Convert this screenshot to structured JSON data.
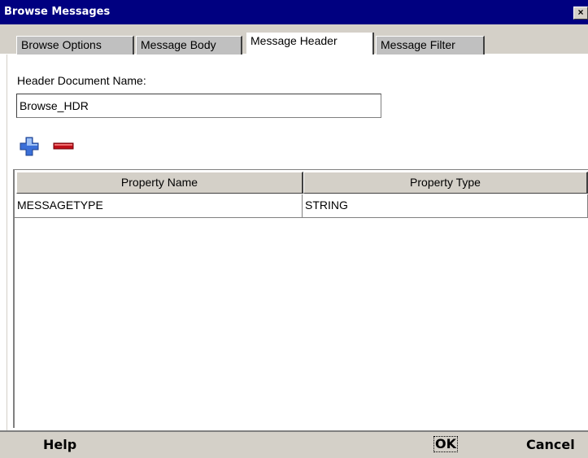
{
  "window": {
    "title": "Browse Messages",
    "close_symbol": "×"
  },
  "tabs": [
    {
      "label": "Browse Options",
      "active": false
    },
    {
      "label": "Message Body",
      "active": false
    },
    {
      "label": "Message Header",
      "active": true
    },
    {
      "label": "Message Filter",
      "active": false
    }
  ],
  "form": {
    "header_document_label": "Header Document Name:",
    "header_document_value": "Browse_HDR"
  },
  "toolbar": {
    "add_icon": "plus-icon",
    "remove_icon": "minus-icon",
    "add_color": "#3a6fd8",
    "remove_color": "#c0101a"
  },
  "table": {
    "columns": [
      "Property Name",
      "Property Type"
    ],
    "rows": [
      [
        "MESSAGETYPE",
        "STRING"
      ]
    ]
  },
  "footer": {
    "help_label": "Help",
    "ok_label": "OK",
    "cancel_label": "Cancel"
  },
  "colors": {
    "titlebar": "#000080",
    "chrome": "#d4d0c8"
  }
}
